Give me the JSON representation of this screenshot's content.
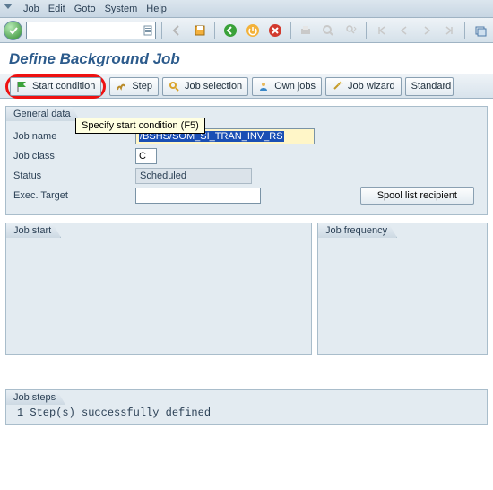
{
  "menu": {
    "items": [
      "Job",
      "Edit",
      "Goto",
      "System",
      "Help"
    ]
  },
  "page": {
    "title": "Define Background Job"
  },
  "toolbar2": {
    "start_condition": "Start condition",
    "step": "Step",
    "job_selection": "Job selection",
    "own_jobs": "Own jobs",
    "job_wizard": "Job wizard",
    "standard": "Standard"
  },
  "tooltip": {
    "text": "Specify start condition   (F5)"
  },
  "general": {
    "tab": "General data",
    "job_name_label": "Job name",
    "job_name_value_sel": "/BSHS/SOM_SI_TRAN_INV_RS",
    "job_class_label": "Job class",
    "job_class_value": "C",
    "status_label": "Status",
    "status_value": "Scheduled",
    "exec_target_label": "Exec. Target",
    "exec_target_value": "",
    "spool_btn": "Spool list recipient"
  },
  "start_group": {
    "tab": "Job start"
  },
  "freq_group": {
    "tab": "Job frequency"
  },
  "steps_group": {
    "tab": "Job steps",
    "message": "1 Step(s) successfully defined"
  }
}
